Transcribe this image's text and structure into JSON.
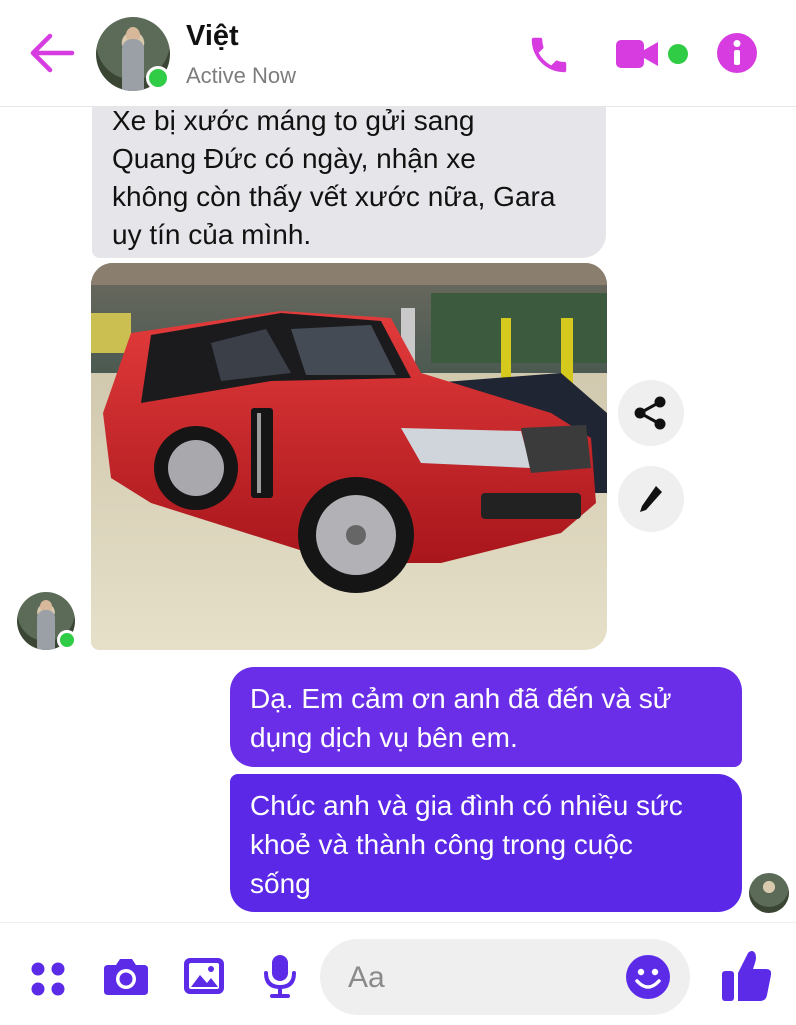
{
  "header": {
    "contact_name": "Việt",
    "status": "Active Now",
    "icons": [
      "back-arrow-icon",
      "phone-icon",
      "video-call-icon",
      "info-icon"
    ],
    "accent_color": "#d63ce0",
    "online_color": "#31cc46"
  },
  "messages": {
    "received_text": "Xe bị xước máng to gửi sang Quang Đức có ngày, nhận xe không còn thấy vết xước nữa, Gara uy tín của mình.",
    "received_lines": [
      "Xe bị xước máng to gửi sang",
      "Quang Đức có ngày, nhận xe",
      "không còn thấy vết xước nữa, Gara",
      "uy tín của mình."
    ],
    "photo_alt": "Red SUV in garage",
    "photo_actions": [
      "share-icon",
      "edit-icon"
    ],
    "sent": [
      {
        "lines": [
          "Dạ. Em cảm ơn anh đã đến và sử",
          "dụng dịch vụ bên em."
        ]
      },
      {
        "lines": [
          "Chúc anh và gia đình có nhiều sức",
          "khoẻ và thành công trong cuộc",
          "sống"
        ]
      }
    ],
    "sent_color": "#6a2ee8"
  },
  "composer": {
    "placeholder": "Aa",
    "icons": [
      "apps-grid-icon",
      "camera-icon",
      "gallery-icon",
      "microphone-icon",
      "emoji-icon",
      "thumbs-up-icon"
    ],
    "icon_color": "#5b2be8"
  }
}
